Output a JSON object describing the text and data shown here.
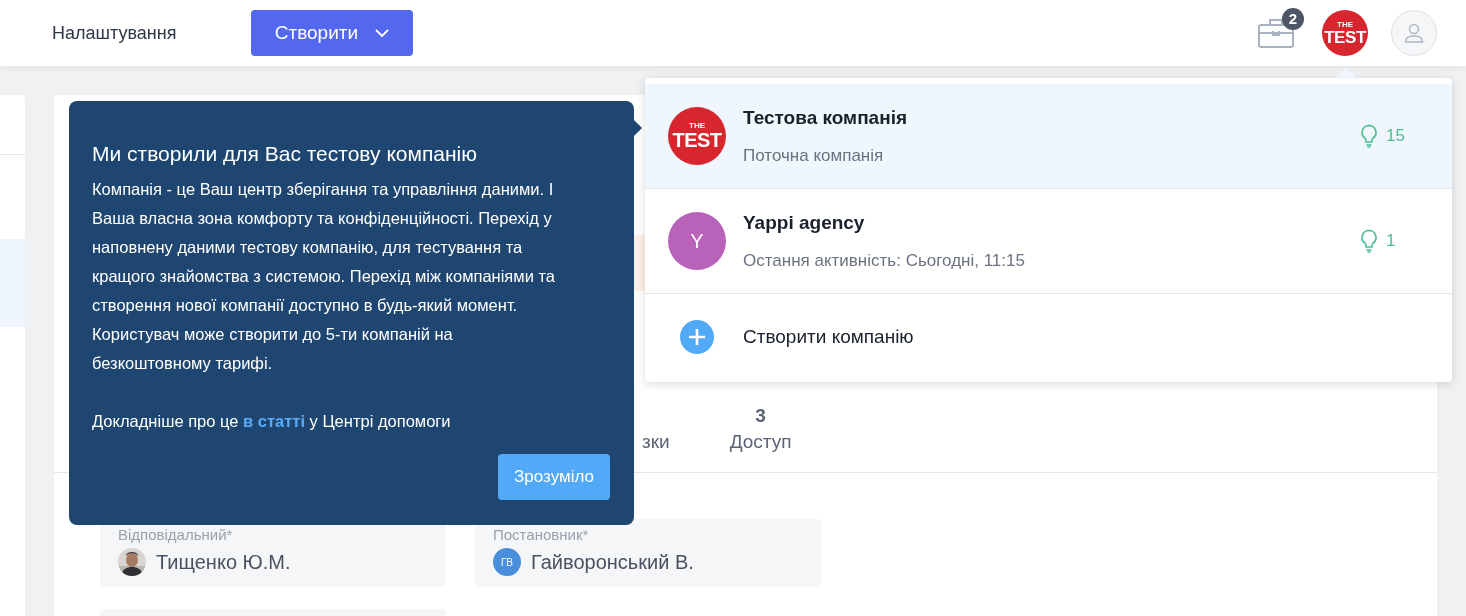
{
  "header": {
    "nav_label": "Налаштування",
    "create_button": "Створити",
    "briefcase_badge": "2",
    "company_logo": {
      "line1": "THE",
      "line2": "TEST"
    }
  },
  "page": {
    "tabs": [
      {
        "label": "зки"
      },
      {
        "number": "3",
        "label": "Доступ"
      }
    ],
    "fields": [
      {
        "label": "Відповідальний*",
        "value": "Тищенко Ю.М."
      },
      {
        "label": "Постановник*",
        "value": "Гайворонський В.",
        "avatar": {
          "kind": "initials",
          "text": "ГВ",
          "color": "#4a8fdb"
        }
      }
    ]
  },
  "tooltip": {
    "title": "Ми створили для Вас тестову компанію",
    "body": "Компанія - це Ваш центр зберігання та управління даними. І Ваша власна зона комфорту та конфіденційності. Перехід у наповнену даними тестову компанію, для тестування та кращого знайомства з системою. Перехід між компаніями та створення нової компанії доступно в будь-який момент. Користувач може створити до 5-ти компаній на безкоштовному тарифі.",
    "more": {
      "before": "Докладніше про це",
      "link": "в статті",
      "after": "у Центрі допомоги"
    },
    "button": "Зрозуміло"
  },
  "company_menu": {
    "companies": [
      {
        "name": "Тестова компанія",
        "subtitle": "Поточна компанія",
        "count": "15",
        "selected": true,
        "avatar": {
          "kind": "logo",
          "line1": "THE",
          "line2": "TEST"
        }
      },
      {
        "name": "Yappi agency",
        "subtitle": "Остання активність: Сьогодні, 11:15",
        "count": "1",
        "selected": false,
        "avatar": {
          "kind": "initial",
          "text": "Y",
          "color": "#b862b9"
        }
      }
    ],
    "create_label": "Створити компанію"
  }
}
